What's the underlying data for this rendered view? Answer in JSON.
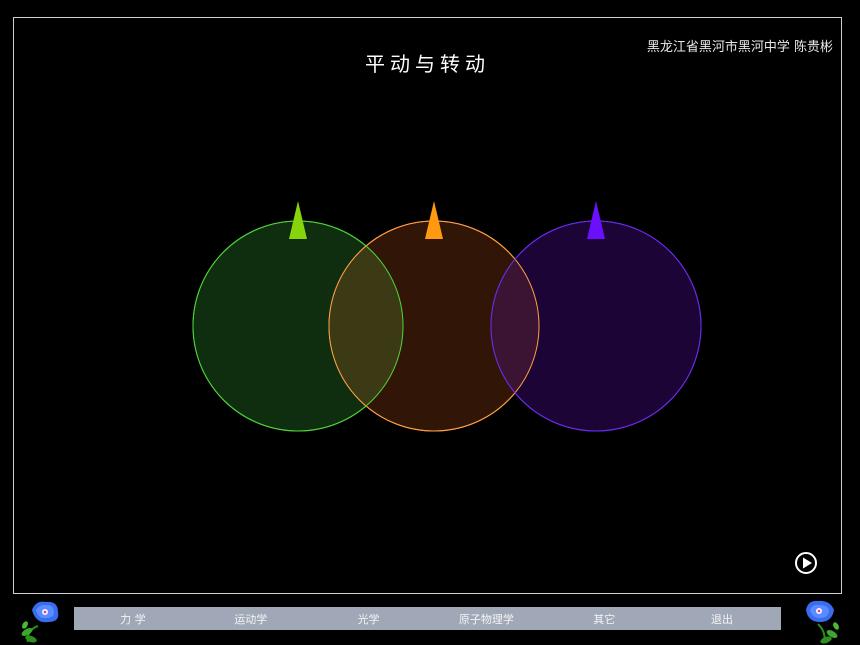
{
  "header": {
    "author": "黑龙江省黑河市黑河中学  陈贵彬",
    "title": "平动与转动"
  },
  "nav": {
    "items": [
      "力 学",
      "运动学",
      "光学",
      "原子物理学",
      "其它",
      "退出"
    ]
  },
  "colors": {
    "background": "#000000",
    "circle_green_fill": "#0f2e0f",
    "circle_green_stroke": "#4fd33b",
    "circle_orange_fill": "#3a1a08",
    "circle_orange_stroke": "#ffa042",
    "circle_purple_fill": "#1c0536",
    "circle_purple_stroke": "#6a2cf0",
    "pointer_green": "#86d40c",
    "pointer_orange": "#ff9a10",
    "pointer_purple": "#6a10ff",
    "nav_bar": "#a0a8b8"
  },
  "icons": {
    "play": "play-circle-icon",
    "flower": "morning-glory-flower-icon"
  }
}
